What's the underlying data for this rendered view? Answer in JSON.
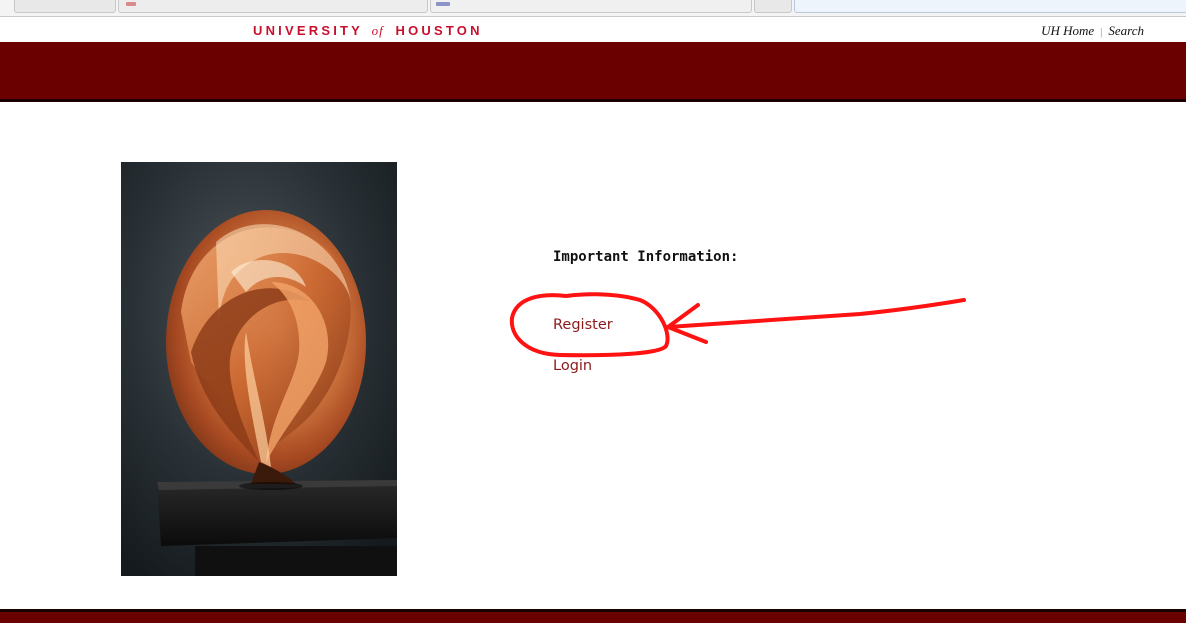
{
  "header": {
    "wordmark": {
      "part1": "UNIVERSITY",
      "part2": "of",
      "part3": "HOUSTON",
      "color": "#c8102e"
    },
    "top_links": {
      "home": "UH Home",
      "separator": "|",
      "search": "Search"
    },
    "banner_color": "#6b0000"
  },
  "main": {
    "image": {
      "subject": "copper spiral sculpture on black pedestal"
    },
    "heading": "Important Information:",
    "links": {
      "register": "Register",
      "login": "Login"
    },
    "link_color": "#8b1a1a"
  },
  "annotation": {
    "color": "#ff0000",
    "description": "hand-drawn circle and arrow around Register"
  }
}
